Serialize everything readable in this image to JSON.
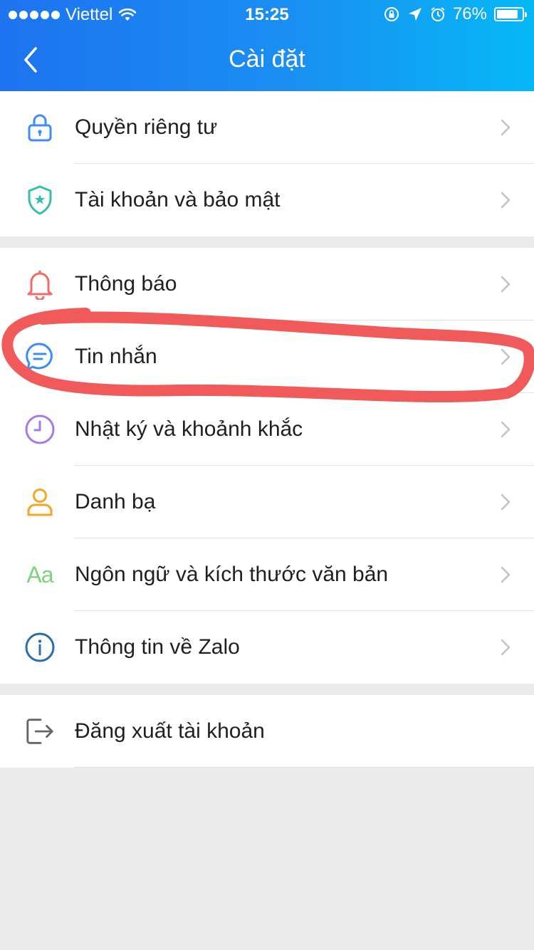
{
  "status_bar": {
    "carrier": "Viettel",
    "time": "15:25",
    "battery": "76%"
  },
  "header": {
    "title": "Cài đặt"
  },
  "colors": {
    "header_gradient_start": "#1e73f0",
    "header_gradient_end": "#06b8f5",
    "annotation_red": "#f05a5a"
  },
  "settings": {
    "group1": [
      {
        "label": "Quyền riêng tư",
        "icon": "lock-icon"
      },
      {
        "label": "Tài khoản và bảo mật",
        "icon": "shield-icon"
      }
    ],
    "group2": [
      {
        "label": "Thông báo",
        "icon": "bell-icon"
      },
      {
        "label": "Tin nhắn",
        "icon": "chat-bubble-icon"
      },
      {
        "label": "Nhật ký và khoảnh khắc",
        "icon": "clock-icon"
      },
      {
        "label": "Danh bạ",
        "icon": "person-icon"
      },
      {
        "label": "Ngôn ngữ và kích thước văn bản",
        "icon": "font-size-icon",
        "icon_text": "Aa"
      },
      {
        "label": "Thông tin về Zalo",
        "icon": "info-icon"
      }
    ],
    "group3": [
      {
        "label": "Đăng xuất tài khoản",
        "icon": "logout-icon"
      }
    ]
  }
}
